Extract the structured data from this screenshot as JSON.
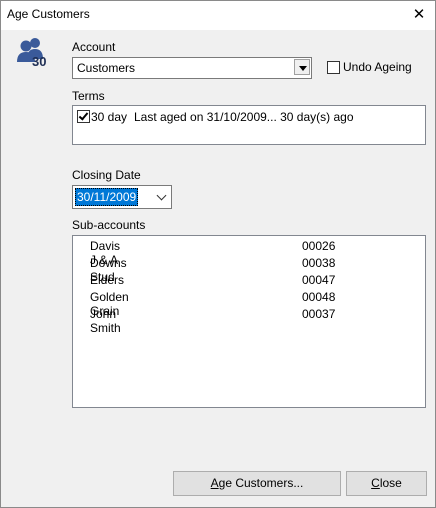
{
  "window": {
    "title": "Age Customers",
    "close_glyph": "✕"
  },
  "app_icon": {
    "name": "customers-icon",
    "number": "30",
    "color": "#3a5a9a"
  },
  "account": {
    "label": "Account",
    "selected": "Customers"
  },
  "undo_ageing": {
    "label": "Undo Ageing",
    "checked": false
  },
  "terms": {
    "label": "Terms",
    "items": [
      {
        "checked": true,
        "name": "30 day",
        "description": "Last aged on 31/10/2009... 30 day(s) ago"
      }
    ]
  },
  "closing_date": {
    "label": "Closing Date",
    "value": "30/11/2009"
  },
  "sub_accounts": {
    "label": "Sub-accounts",
    "rows": [
      {
        "name": "Davis J & A",
        "code": "00026"
      },
      {
        "name": "Downs Stud",
        "code": "00038"
      },
      {
        "name": "Elders",
        "code": "00047"
      },
      {
        "name": "Golden Grain",
        "code": "00048"
      },
      {
        "name": "John Smith",
        "code": "00037"
      }
    ]
  },
  "buttons": {
    "age_mnemonic": "A",
    "age_rest": "ge Customers...",
    "close_mnemonic": "C",
    "close_rest": "lose"
  }
}
